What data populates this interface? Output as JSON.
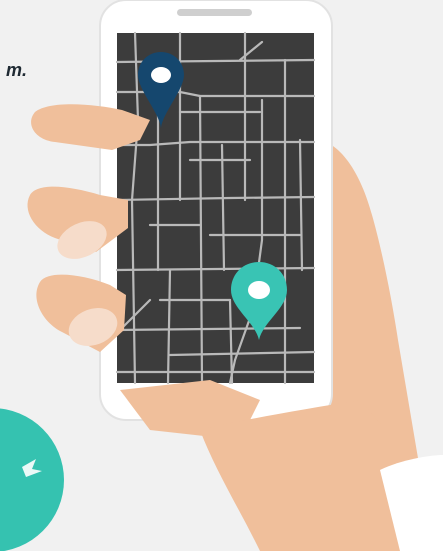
{
  "caption": {
    "text": "m."
  },
  "colors": {
    "background": "#f1f1f1",
    "phone_body": "#ffffff",
    "phone_border": "#e2e2e2",
    "screen": "#3c3c3c",
    "roads": "#b9b9b9",
    "skin": "#f0bf9b",
    "skin_shadow": "#e3a983",
    "nail": "#f6dcca",
    "sleeve": "#ffffff",
    "pin_primary": "#15476e",
    "pin_secondary": "#39c4b4",
    "badge": "#35c2b0"
  },
  "map": {
    "pins": [
      {
        "name": "origin-pin",
        "color": "#15476e"
      },
      {
        "name": "destination-pin",
        "color": "#39c4b4"
      }
    ]
  }
}
